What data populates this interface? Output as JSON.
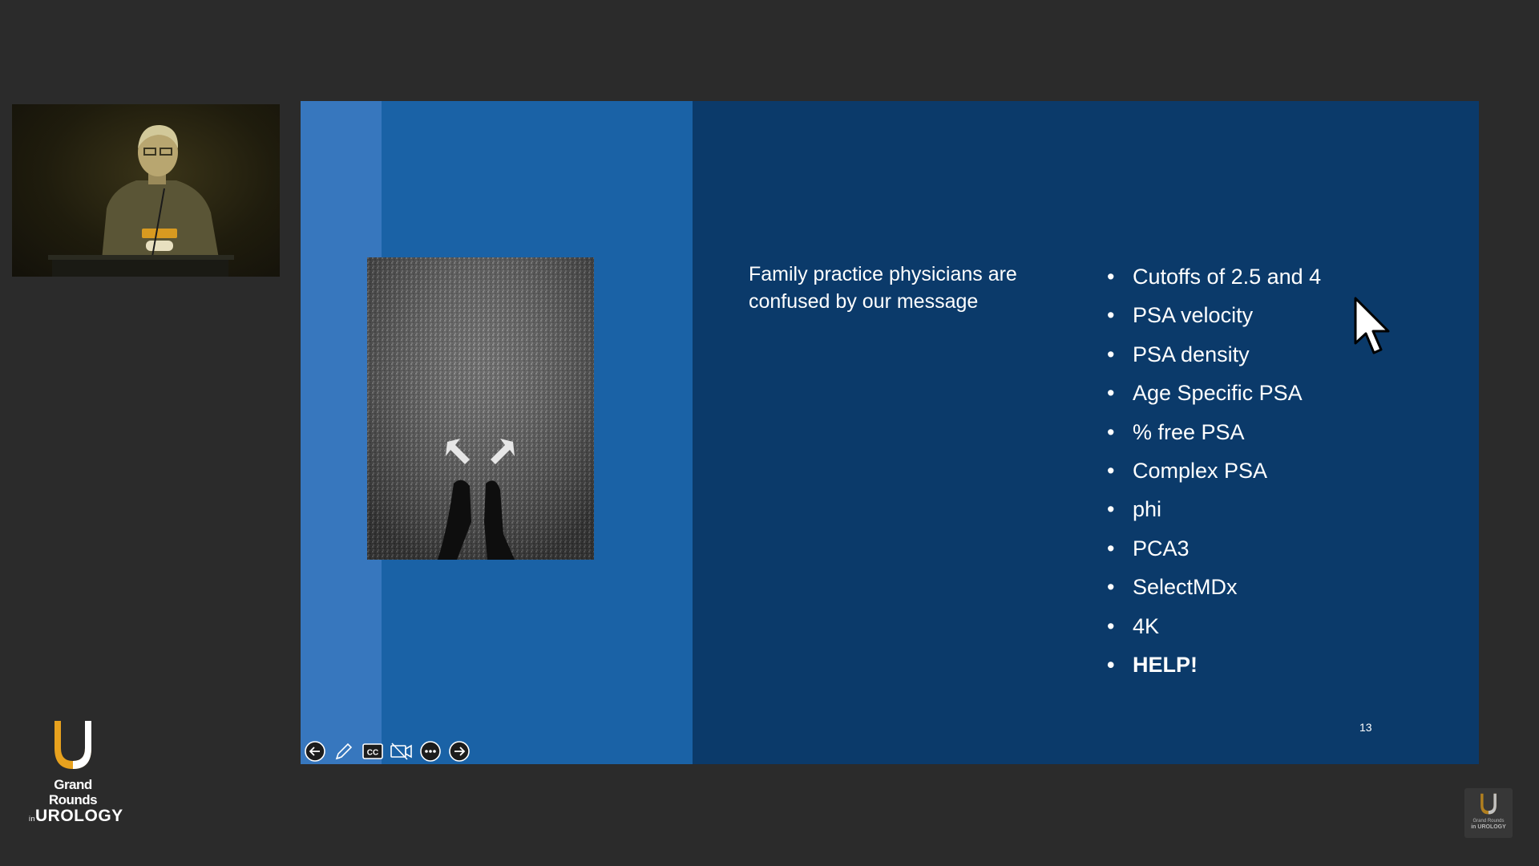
{
  "slide": {
    "left_text": "Family practice physicians are confused by our message",
    "bullets": [
      "Cutoffs of 2.5 and 4",
      "PSA velocity",
      "PSA density",
      "Age Specific PSA",
      "% free PSA",
      "Complex PSA",
      "phi",
      "PCA3",
      "SelectMDx",
      "4K",
      "HELP!"
    ],
    "page_number": "13"
  },
  "toolbar": {
    "buttons": [
      "previous-slide",
      "pen",
      "closed-captions",
      "camera-off",
      "more-options",
      "next-slide"
    ],
    "cc_label": "CC"
  },
  "logo": {
    "line1": "Grand Rounds",
    "line2_prefix": "in",
    "line2": "UROLOGY"
  },
  "watermark": {
    "line1": "Grand Rounds",
    "line2": "in UROLOGY"
  },
  "colors": {
    "background": "#2b2b2b",
    "slide_dark": "#0b3a6a",
    "slide_mid": "#1a62a6",
    "slide_light": "#3777be",
    "brand_orange": "#e8a21e"
  }
}
